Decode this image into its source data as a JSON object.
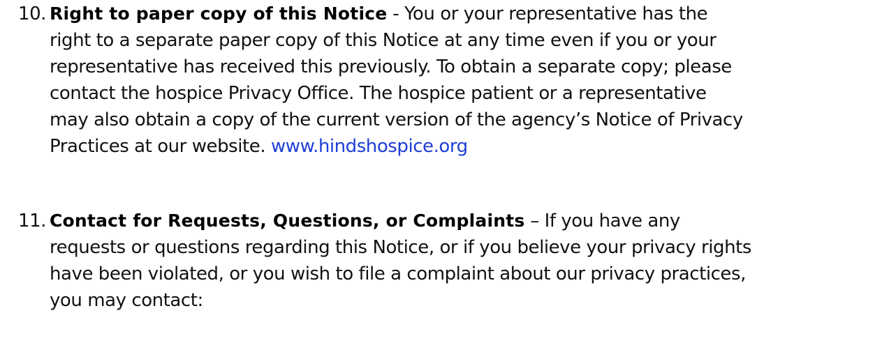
{
  "items": [
    {
      "number": "10.",
      "heading": "Right to paper copy of this Notice",
      "first_line_rest": " - You or your representative has the",
      "lines": [
        "right to a separate paper copy of this Notice at any time even if you or your",
        "representative has received this previously. To obtain a separate copy; please",
        "contact the hospice Privacy Office. The hospice patient or a representative",
        "may also obtain a copy of the current version of the agency’s Notice of Privacy"
      ],
      "last_line_text": "Practices at our website. ",
      "link": "www.hindshospice.org"
    },
    {
      "number": "11.",
      "heading": "Contact for Requests, Questions, or Complaints",
      "first_line_rest": " – If you have any",
      "lines": [
        "requests or questions regarding this Notice, or if you believe your privacy rights",
        "have been violated, or you wish to file a complaint about our privacy practices,",
        "you may contact:"
      ]
    }
  ],
  "colors": {
    "link": "#1f3fd6",
    "text": "#111111"
  }
}
